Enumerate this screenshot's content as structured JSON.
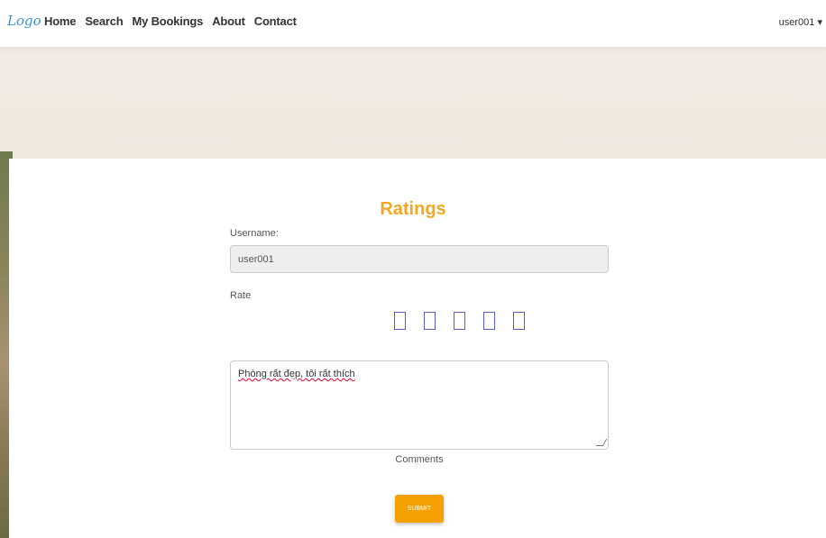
{
  "navbar": {
    "logo": "Logo",
    "links": [
      "Home",
      "Search",
      "My Bookings",
      "About",
      "Contact"
    ],
    "user": "user001 ▾"
  },
  "form": {
    "title": "Ratings",
    "username_label": "Username:",
    "username_value": "user001",
    "rate_label": "Rate",
    "rating_value": 0,
    "rating_max": 5,
    "comment_value": "Phòng rất đẹp, tôi rất thích",
    "comments_label": "Comments",
    "submit_label": "SUBMIT"
  },
  "colors": {
    "accent": "#f5a623",
    "button": "#f5a000",
    "logo": "#3a8fd8",
    "star_border": "#5b5bd6"
  }
}
